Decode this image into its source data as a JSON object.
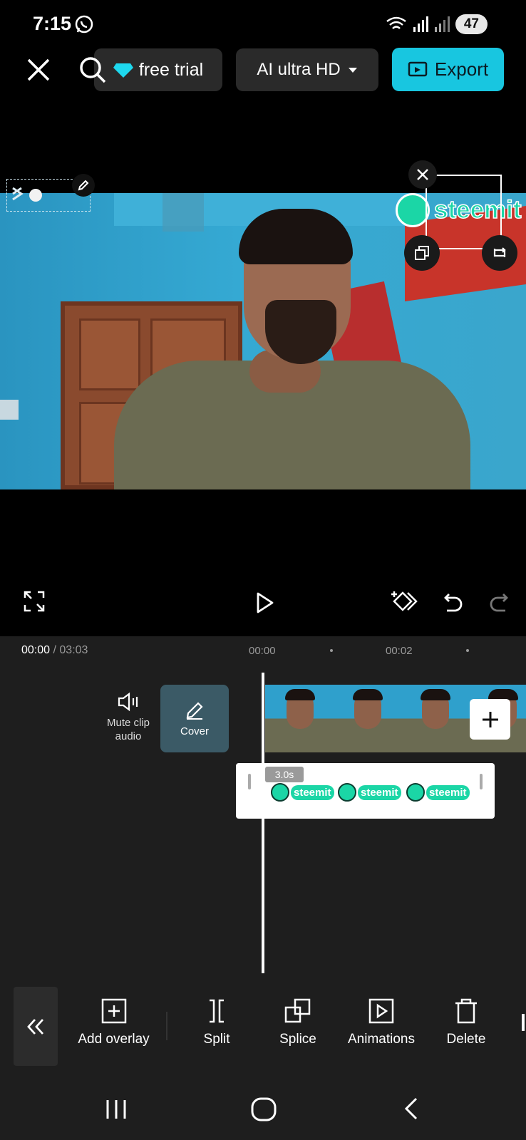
{
  "status_bar": {
    "time": "7:15",
    "battery": "47"
  },
  "top_bar": {
    "trial_label": "free trial",
    "quality_label": "AI ultra HD",
    "export_label": "Export"
  },
  "overlay_sticker": {
    "text": "steemit"
  },
  "timeline": {
    "current_time": "00:00",
    "total_time": "/ 03:03",
    "ticks": [
      "00:00",
      "00:02"
    ],
    "mute_label": "Mute clip audio",
    "cover_label": "Cover",
    "overlay_duration": "3.0s",
    "overlay_logo_text": "steemit"
  },
  "toolbar": {
    "items": [
      {
        "label": "Add overlay",
        "icon": "add-overlay-icon"
      },
      {
        "label": "Split",
        "icon": "split-icon"
      },
      {
        "label": "Splice",
        "icon": "splice-icon"
      },
      {
        "label": "Animations",
        "icon": "animations-icon"
      },
      {
        "label": "Delete",
        "icon": "delete-icon"
      }
    ]
  },
  "colors": {
    "accent": "#18c6e0",
    "sticker": "#1bd6a6",
    "panel": "#1e1e1e"
  }
}
